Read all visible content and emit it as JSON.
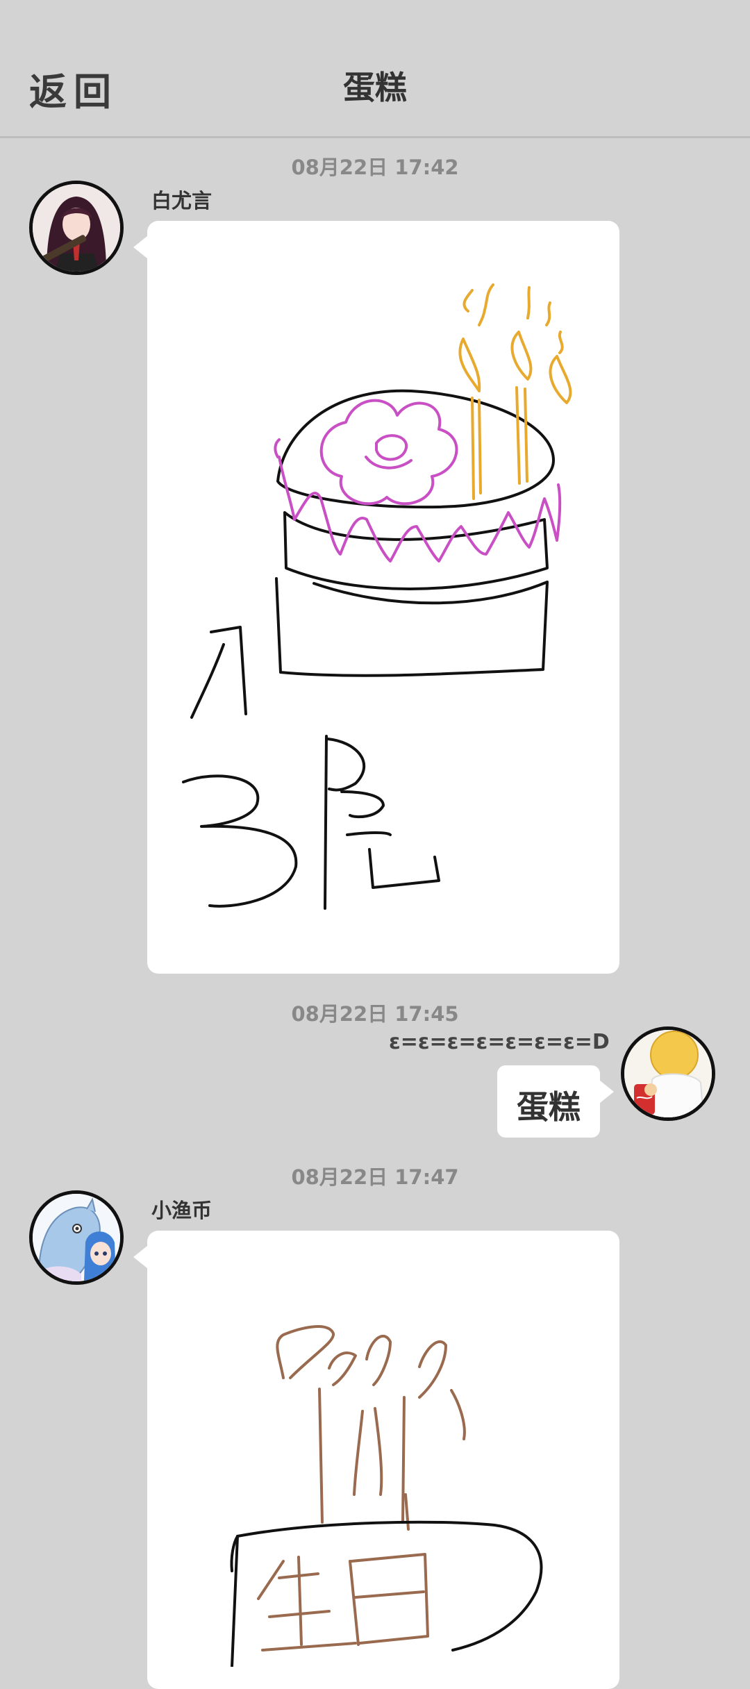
{
  "header": {
    "back_label": "返回",
    "title": "蛋糕"
  },
  "messages": [
    {
      "timestamp": "08月22日  17:42",
      "sender": "白尤言",
      "type": "drawing",
      "drawing_text": [
        "小",
        "3层"
      ]
    },
    {
      "timestamp": "08月22日  17:45",
      "side": "right",
      "caption": "ε=ε=ε=ε=ε=ε=ε=D",
      "text": "蛋糕"
    },
    {
      "timestamp": "08月22日  17:47",
      "sender": "小渔币",
      "type": "drawing",
      "drawing_text": [
        "生日"
      ]
    }
  ],
  "colors": {
    "background": "#d3d3d3",
    "bubble": "#ffffff",
    "pink": "#c94fc4",
    "orange": "#e8aa2e",
    "brown": "#9a6a4f"
  }
}
